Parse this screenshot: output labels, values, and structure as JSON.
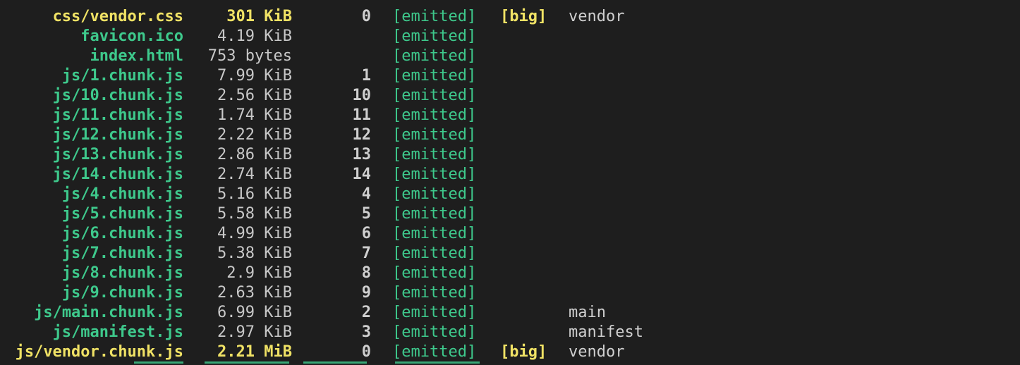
{
  "terminal": {
    "rows": [
      {
        "asset": "css/vendor.css",
        "size": "301 KiB",
        "chunks": "0",
        "status": "[emitted]",
        "flag": "[big]",
        "chunk_names": "vendor",
        "big": true
      },
      {
        "asset": "favicon.ico",
        "size": "4.19 KiB",
        "chunks": "",
        "status": "[emitted]",
        "flag": "",
        "chunk_names": "",
        "big": false
      },
      {
        "asset": "index.html",
        "size": "753 bytes",
        "chunks": "",
        "status": "[emitted]",
        "flag": "",
        "chunk_names": "",
        "big": false
      },
      {
        "asset": "js/1.chunk.js",
        "size": "7.99 KiB",
        "chunks": "1",
        "status": "[emitted]",
        "flag": "",
        "chunk_names": "",
        "big": false
      },
      {
        "asset": "js/10.chunk.js",
        "size": "2.56 KiB",
        "chunks": "10",
        "status": "[emitted]",
        "flag": "",
        "chunk_names": "",
        "big": false
      },
      {
        "asset": "js/11.chunk.js",
        "size": "1.74 KiB",
        "chunks": "11",
        "status": "[emitted]",
        "flag": "",
        "chunk_names": "",
        "big": false
      },
      {
        "asset": "js/12.chunk.js",
        "size": "2.22 KiB",
        "chunks": "12",
        "status": "[emitted]",
        "flag": "",
        "chunk_names": "",
        "big": false
      },
      {
        "asset": "js/13.chunk.js",
        "size": "2.86 KiB",
        "chunks": "13",
        "status": "[emitted]",
        "flag": "",
        "chunk_names": "",
        "big": false
      },
      {
        "asset": "js/14.chunk.js",
        "size": "2.74 KiB",
        "chunks": "14",
        "status": "[emitted]",
        "flag": "",
        "chunk_names": "",
        "big": false
      },
      {
        "asset": "js/4.chunk.js",
        "size": "5.16 KiB",
        "chunks": "4",
        "status": "[emitted]",
        "flag": "",
        "chunk_names": "",
        "big": false
      },
      {
        "asset": "js/5.chunk.js",
        "size": "5.58 KiB",
        "chunks": "5",
        "status": "[emitted]",
        "flag": "",
        "chunk_names": "",
        "big": false
      },
      {
        "asset": "js/6.chunk.js",
        "size": "4.99 KiB",
        "chunks": "6",
        "status": "[emitted]",
        "flag": "",
        "chunk_names": "",
        "big": false
      },
      {
        "asset": "js/7.chunk.js",
        "size": "5.38 KiB",
        "chunks": "7",
        "status": "[emitted]",
        "flag": "",
        "chunk_names": "",
        "big": false
      },
      {
        "asset": "js/8.chunk.js",
        "size": "2.9 KiB",
        "chunks": "8",
        "status": "[emitted]",
        "flag": "",
        "chunk_names": "",
        "big": false
      },
      {
        "asset": "js/9.chunk.js",
        "size": "2.63 KiB",
        "chunks": "9",
        "status": "[emitted]",
        "flag": "",
        "chunk_names": "",
        "big": false
      },
      {
        "asset": "js/main.chunk.js",
        "size": "6.99 KiB",
        "chunks": "2",
        "status": "[emitted]",
        "flag": "",
        "chunk_names": "main",
        "big": false
      },
      {
        "asset": "js/manifest.js",
        "size": "2.97 KiB",
        "chunks": "3",
        "status": "[emitted]",
        "flag": "",
        "chunk_names": "manifest",
        "big": false
      },
      {
        "asset": "js/vendor.chunk.js",
        "size": "2.21 MiB",
        "chunks": "0",
        "status": "[emitted]",
        "flag": "[big]",
        "chunk_names": "vendor",
        "big": true
      }
    ]
  },
  "colors": {
    "background": "#1e1e1e",
    "emitted_green": "#3ec98c",
    "big_yellow": "#f0e265",
    "default_text": "#d4d4d4"
  }
}
